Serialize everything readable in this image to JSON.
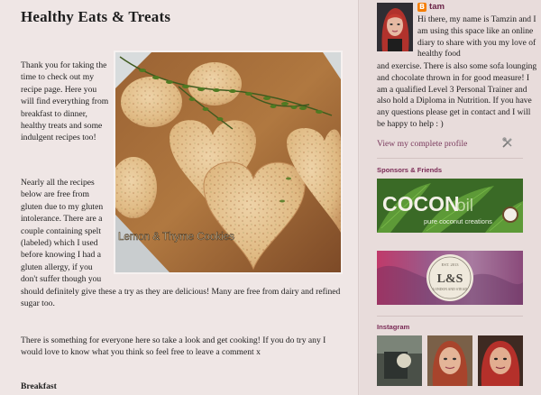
{
  "post": {
    "title": "Healthy Eats & Treats",
    "intro": "Thank you for taking the time to check out my recipe page. Here you will find everything from breakfast to dinner, healthy treats and some indulgent recipes too!",
    "para2_left": "Nearly all the recipes below are free from gluten due to my gluten intolerance. There are a couple containing spelt (labeled) which I used before knowing I had a gluten allergy, if you don't suffer though you",
    "para2_wide": "should definitely give these a try as they are delicious! Many are free from dairy and refined sugar too.",
    "para3": "There is something for everyone here so take a look and get cooking! If you do try any I would love to know what you think so feel free to leave a comment x",
    "section_head": "Breakfast",
    "photo_caption": "Lemon & Thyme Cookies"
  },
  "sidebar": {
    "author_name": "tam",
    "about_short": "Hi there, my name is Tamzin and I am using this space like an online diary to share with you my love of healthy food",
    "about_rest": "and exercise. There is also some sofa lounging and chocolate thrown in for good measure! I am a qualified Level 3 Personal Trainer and also hold a Diploma in Nutrition. If you have any questions please get in contact and I will be happy to help : )",
    "profile_link": "View my complete profile",
    "sponsors_title": "Sponsors & Friends",
    "sponsor1_brand": "COCON",
    "sponsor1_brand_light": "oil",
    "sponsor1_tagline": "pure coconut creations",
    "sponsor2_brand": "L&S",
    "sponsor2_top": "EST. 2013",
    "sponsor2_bottom": "LONDON AND STEAD",
    "instagram_title": "Instagram"
  },
  "colors": {
    "accent": "#7a2a55",
    "link": "#7a3a5d",
    "blogger": "#f57d00"
  },
  "icons": {
    "blogger": "blogger-icon",
    "tools": "screwdriver-wrench-icon"
  }
}
